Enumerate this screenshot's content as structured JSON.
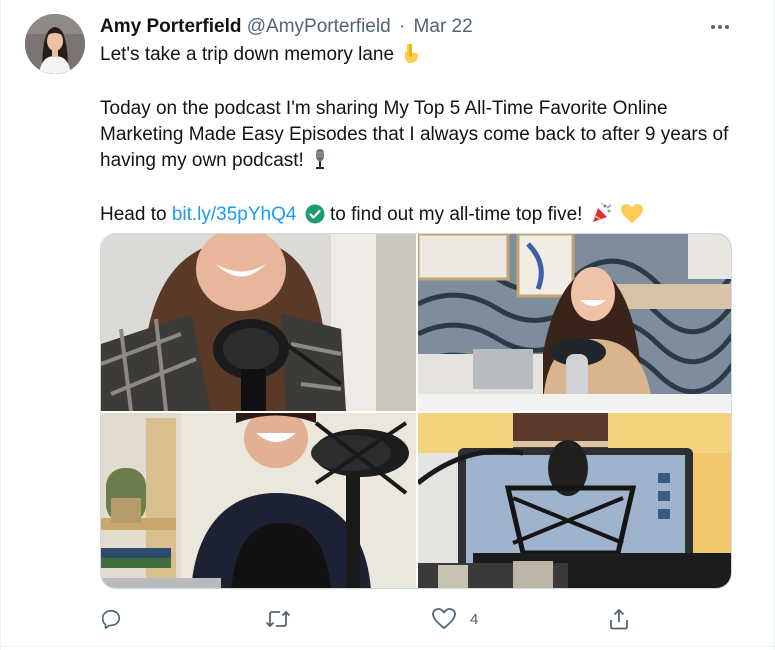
{
  "tweet": {
    "author_name": "Amy Porterfield",
    "handle": "@AmyPorterfield",
    "separator": "·",
    "date": "Mar 22",
    "line1": "Let's take a trip down memory lane",
    "line2": "Today on the podcast I'm sharing My Top 5 All-Time Favorite Online Marketing Made Easy Episodes that I always come back to after 9 years of having my own podcast!",
    "line3_prefix": "Head to",
    "link_text": "bit.ly/35pYhQ4",
    "line3_suffix": "to find out my all-time top five!",
    "emojis": [
      "pointing-down-emoji",
      "microphone-emoji",
      "check-mark-emoji",
      "party-popper-emoji",
      "yellow-heart-emoji"
    ]
  },
  "media": {
    "photos": [
      {
        "name": "photo-woman-laughing-with-microphone"
      },
      {
        "name": "photo-woman-at-desk-with-microphone"
      },
      {
        "name": "photo-woman-smiling-at-microphone"
      },
      {
        "name": "photo-microphone-and-laptop"
      }
    ]
  },
  "actions": {
    "reply_icon": "reply-icon",
    "retweet_icon": "retweet-icon",
    "like_icon": "like-icon",
    "like_count": "4",
    "share_icon": "share-icon"
  },
  "colors": {
    "text": "#0f1419",
    "secondary": "#536471",
    "link": "#1d9bf0",
    "border": "#eff3f4"
  }
}
